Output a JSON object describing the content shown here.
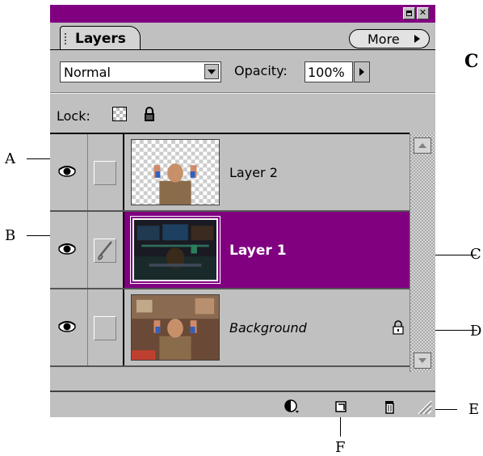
{
  "panel": {
    "tab_label": "Layers",
    "more_label": "More",
    "window_buttons": [
      "minimize-icon",
      "close-icon"
    ]
  },
  "controls": {
    "blend_mode": "Normal",
    "opacity_label": "Opacity:",
    "opacity_value": "100%",
    "lock_label": "Lock:"
  },
  "layers": [
    {
      "name": "Layer 2",
      "visible": true,
      "selected": false,
      "locked": false,
      "brush": false
    },
    {
      "name": "Layer 1",
      "visible": true,
      "selected": true,
      "locked": false,
      "brush": true
    },
    {
      "name": "Background",
      "visible": true,
      "selected": false,
      "locked": true,
      "brush": false
    }
  ],
  "footer_icons": [
    "adjustment-layer-icon",
    "new-layer-icon",
    "trash-icon"
  ],
  "annotations": {
    "A": "A",
    "B": "B",
    "C_top": "C",
    "C": "C",
    "D": "D",
    "E": "E",
    "F": "F"
  },
  "colors": {
    "accent": "#800080",
    "panel_bg": "#c0c0c0"
  }
}
